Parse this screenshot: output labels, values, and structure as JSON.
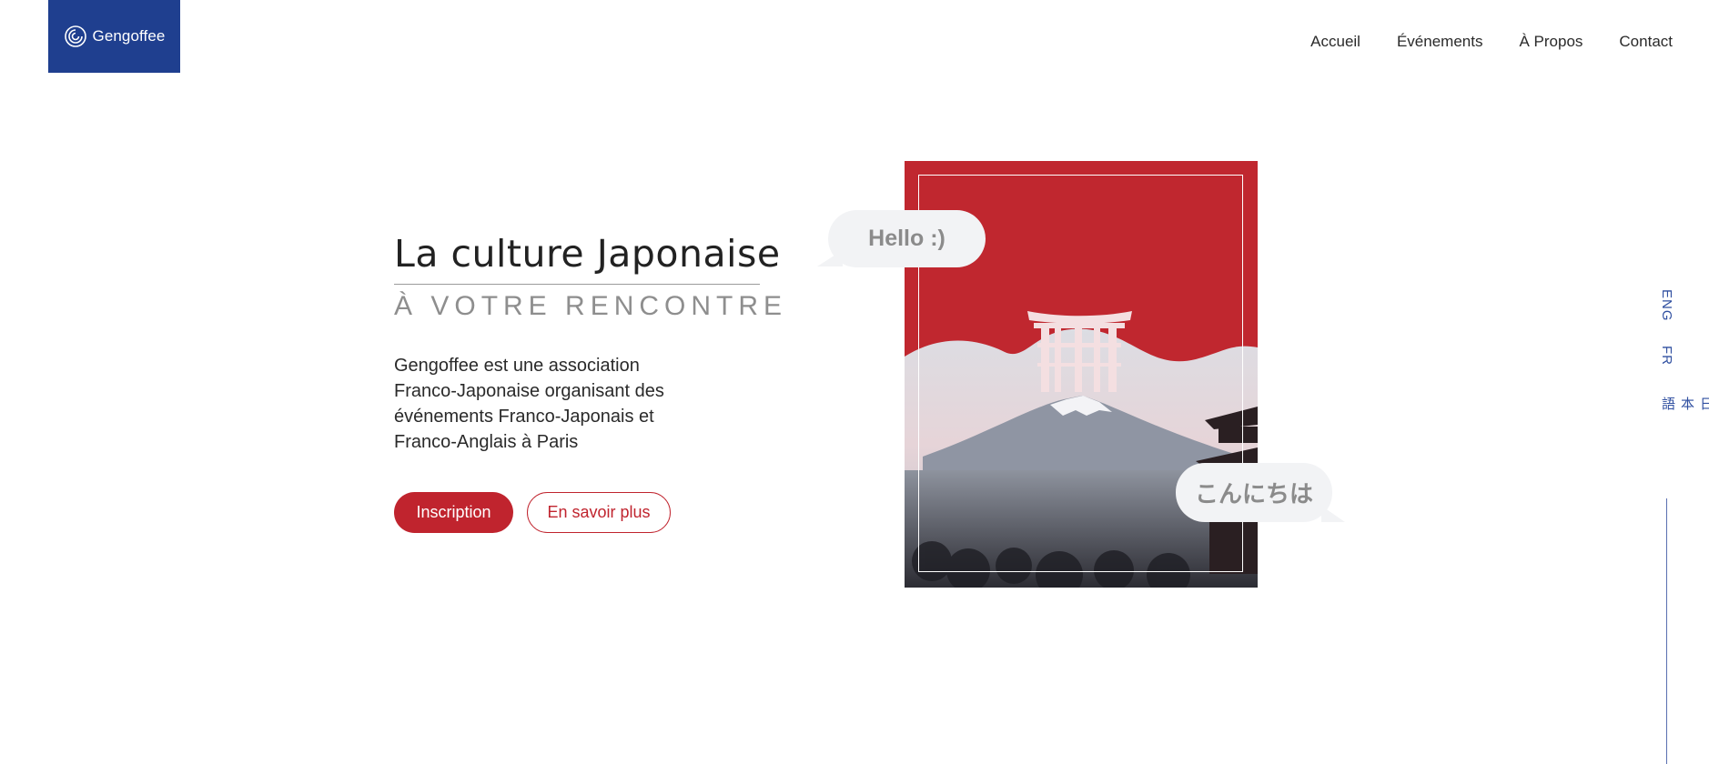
{
  "brand": {
    "name": "Gengoffee",
    "color": "#1f3f8f"
  },
  "nav": {
    "items": [
      {
        "label": "Accueil"
      },
      {
        "label": "Événements"
      },
      {
        "label": "À Propos"
      },
      {
        "label": "Contact"
      }
    ]
  },
  "hero": {
    "title": "La culture Japonaise",
    "subtitle": "À VOTRE RENCONTRE",
    "description": "Gengoffee est une association Franco-Japonaise organisant des événements Franco-Japonais et Franco-Anglais à Paris",
    "primary_button": "Inscription",
    "secondary_button": "En savoir plus",
    "accent_color": "#c0242e"
  },
  "illustration": {
    "bubble_hello": "Hello :)",
    "bubble_konnichiwa": "こんにちは"
  },
  "language_switcher": {
    "items": [
      {
        "label": "ENG"
      },
      {
        "label": "FR"
      },
      {
        "label": "日本語"
      }
    ],
    "color": "#2f4fa0"
  }
}
